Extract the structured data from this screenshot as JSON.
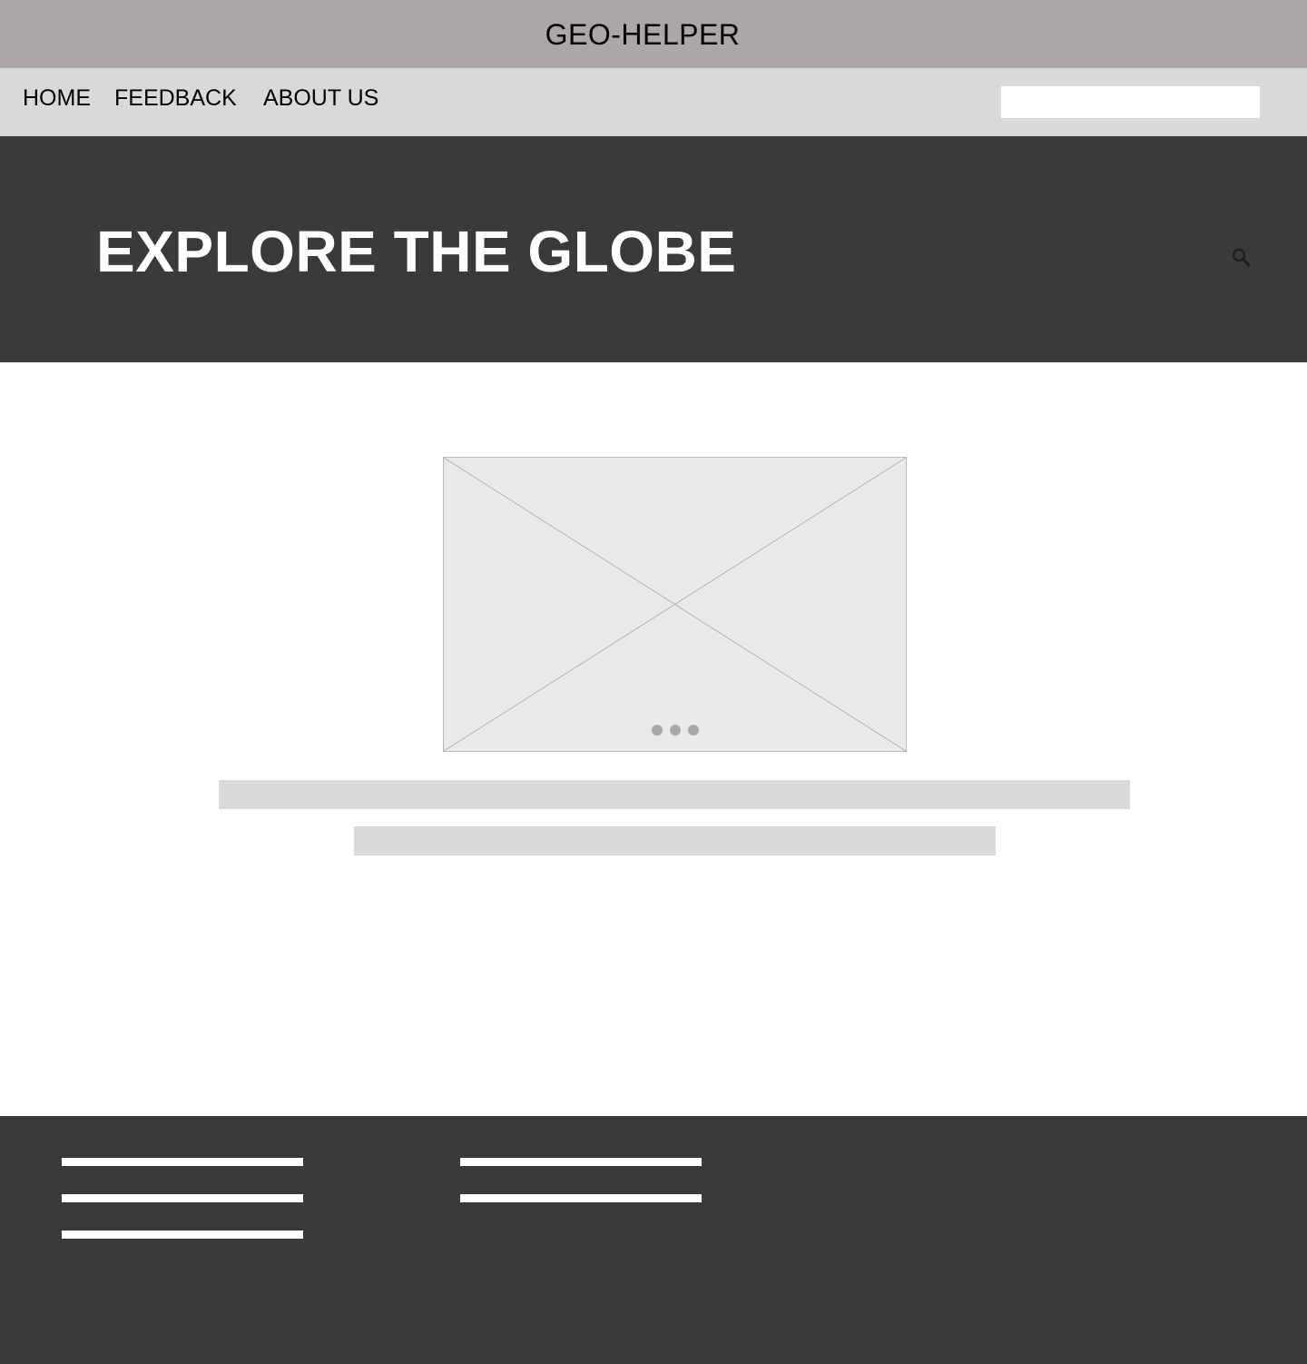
{
  "header": {
    "site_title": "GEO-HELPER"
  },
  "nav": {
    "items": [
      {
        "label": "HOME"
      },
      {
        "label": "FEEDBACK"
      },
      {
        "label": "ABOUT US"
      }
    ],
    "search": {
      "value": "",
      "placeholder": ""
    }
  },
  "hero": {
    "title": "EXPLORE THE GLOBE",
    "icon": "search-icon"
  },
  "carousel": {
    "image": "image-placeholder",
    "slide_count": 3
  },
  "colors": {
    "topbar": "#aca6a6",
    "navbar": "#d9d9d9",
    "hero": "#3b393a",
    "footer": "#3b393a",
    "placeholder": "#eaeaea"
  }
}
